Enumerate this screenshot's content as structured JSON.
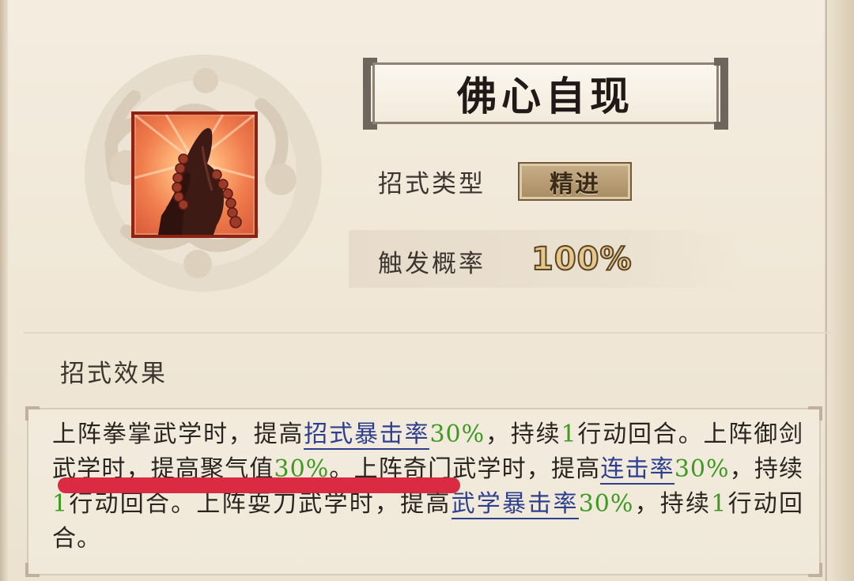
{
  "skill": {
    "name": "佛心自现",
    "icon": "praying-hands-with-beads-icon",
    "type_label": "招式类型",
    "type_value": "精进",
    "rate_label": "触发概率",
    "rate_value": "100%"
  },
  "effect": {
    "title": "招式效果",
    "segments": [
      {
        "t": "上阵拳掌武学时，提高"
      },
      {
        "t": "招式暴击率",
        "k": "kw"
      },
      {
        "t": "30%",
        "k": "num"
      },
      {
        "t": "，持续"
      },
      {
        "t": "1",
        "k": "num"
      },
      {
        "t": "行动回合。上阵御剑武学时，提高聚气值"
      },
      {
        "t": "30%",
        "k": "num"
      },
      {
        "t": "。上阵奇门武学时，提高"
      },
      {
        "t": "连击率",
        "k": "kw"
      },
      {
        "t": "30%",
        "k": "num"
      },
      {
        "t": "，持续"
      },
      {
        "t": "1",
        "k": "num"
      },
      {
        "t": "行动回合。上阵耍刀武学时，提高"
      },
      {
        "t": "武学暴击率",
        "k": "kw"
      },
      {
        "t": "30%",
        "k": "num"
      },
      {
        "t": "，持续"
      },
      {
        "t": "1",
        "k": "num"
      },
      {
        "t": "行动回合。"
      }
    ]
  },
  "colors": {
    "keyword": "#2d3f8f",
    "number": "#3f9a22",
    "highlight": "#d8223c",
    "icon_border": "#8f2214"
  }
}
